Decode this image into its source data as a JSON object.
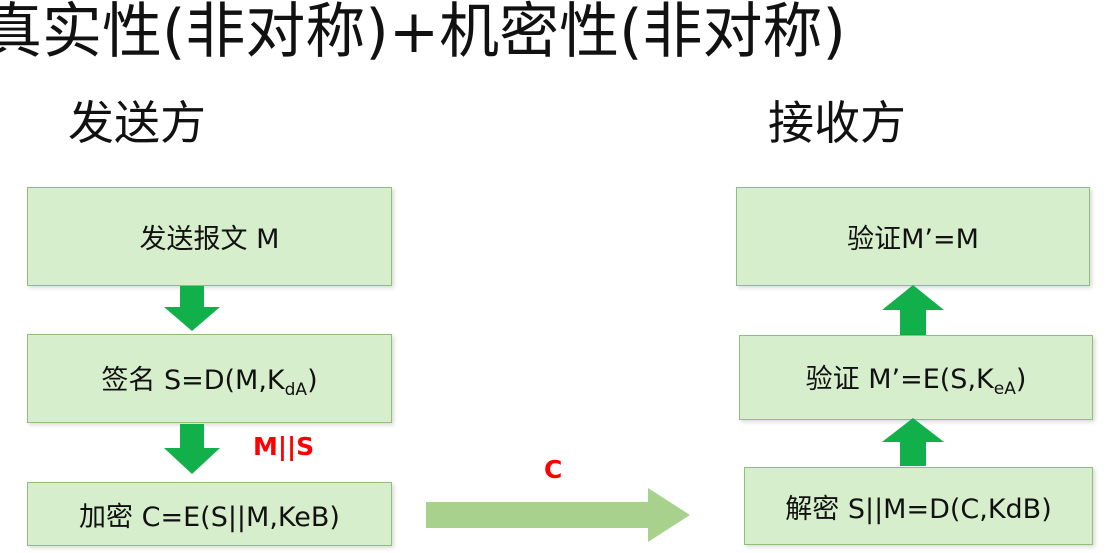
{
  "title": "真实性(非对称)+机密性(非对称)",
  "sender": {
    "label": "发送方",
    "steps": [
      {
        "text": "发送报文 M"
      },
      {
        "text": "签名 S=D(M,K",
        "sub": "dA",
        "tail": ")"
      },
      {
        "text": "加密 C=E(S||M,KeB)"
      }
    ],
    "edge_label": "M||S"
  },
  "channel": {
    "label": "C"
  },
  "receiver": {
    "label": "接收方",
    "steps": [
      {
        "text": "验证M’=M"
      },
      {
        "text": "验证 M’=E(S,K",
        "sub": "eA",
        "tail": ")"
      },
      {
        "text": "解密 S||M=D(C,KdB)"
      }
    ]
  },
  "colors": {
    "box_fill": "#d6eecb",
    "box_border": "#8fbf78",
    "arrow_green": "#12b04a",
    "channel_arrow": "#a9d18e",
    "label_red": "#ff0000"
  }
}
